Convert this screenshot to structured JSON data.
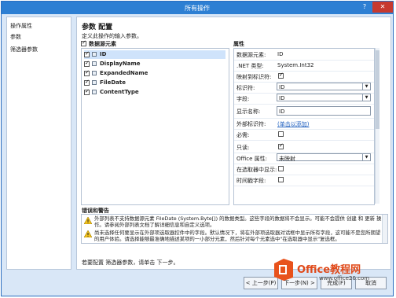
{
  "window": {
    "title": "所有操作",
    "help_label": "?",
    "close_label": "✕"
  },
  "nav": {
    "items": [
      {
        "label": "操作属性"
      },
      {
        "label": "参数"
      },
      {
        "label": "筛选器参数"
      }
    ]
  },
  "main": {
    "title": "参数 配置",
    "subtitle": "定义此操作的输入参数。",
    "tree_header": "数据源元素",
    "tree_items": [
      {
        "label": "ID",
        "checked": true
      },
      {
        "label": "DisplayName",
        "checked": true
      },
      {
        "label": "ExpandedName",
        "checked": true
      },
      {
        "label": "FileDate",
        "checked": true
      },
      {
        "label": "ContentType",
        "checked": true
      }
    ],
    "props_header": "属性",
    "props": {
      "source_element_label": "数据源元素:",
      "source_element_value": "ID",
      "net_type_label": ".NET 类型:",
      "net_type_value": "System.Int32",
      "map_identifier_label": "映射到标识符:",
      "identifier_label": "标识符:",
      "identifier_value": "ID",
      "field_label": "字段:",
      "field_value": "ID",
      "display_name_label": "显示名称:",
      "display_name_value": "ID",
      "external_id_label": "外部标识符:",
      "external_id_link": "(单击以添加)",
      "required_label": "必需:",
      "readonly_label": "只读:",
      "office_prop_label": "Office 属性:",
      "office_prop_value": "未映射",
      "show_in_picker_label": "在选取器中显示:",
      "timestamp_label": "时间戳字段:"
    },
    "errors_header": "错误和警告",
    "errors": [
      {
        "text": "外部列表不支持数据源元素 FileDate (System.Byte[]) 的数据类型。这些字段的数据将不会显示。可能不会提供 创建 和 更新 操作。请参阅外部列表文档了解详细信息和自定义选项。"
      },
      {
        "text": "尚未选择任何要显示在外部项选取器控件中的字段。默认情况下，将在外部项选取器对话框中显示所有字段，这可能不是您所期望的用户体验。请选择能够最准确地描述某项的一小部分元素，然后针对每个元素选中\"在选取器中显示\"复选框。"
      }
    ],
    "footer_message": "若要配置 筛选器参数，请单击 下一步。"
  },
  "buttons": {
    "back": "< 上一步(P)",
    "next": "下一步(N) >",
    "finish": "完成(F)",
    "cancel": "取消"
  },
  "watermark": {
    "brand": "Office教程网",
    "url": "www.office26.com"
  }
}
